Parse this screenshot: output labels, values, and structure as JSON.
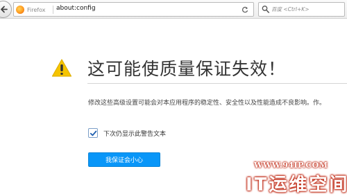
{
  "toolbar": {
    "identity_label": "Firefox",
    "url": "about:config",
    "search_placeholder": "百度 <Ctrl+K>"
  },
  "warning": {
    "title": "这可能使质量保证失效！",
    "description": "修改这些高级设置可能会对本应用程序的稳定性、安全性以及性能造成不良影响。作。",
    "checkbox_label": "下次仍显示此警告文本",
    "checkbox_checked": true,
    "button_label": "我保证会小心"
  },
  "watermark": {
    "url": "WWW.94IP.COM",
    "brand": "IT运维空间"
  },
  "colors": {
    "button": "#0996f8",
    "warning_icon": "#f5c400",
    "watermark_outline": "#c2301c"
  },
  "icons": [
    "back-arrow-icon",
    "firefox-logo-icon",
    "reload-icon",
    "search-icon",
    "warning-icon",
    "checkmark-icon"
  ]
}
